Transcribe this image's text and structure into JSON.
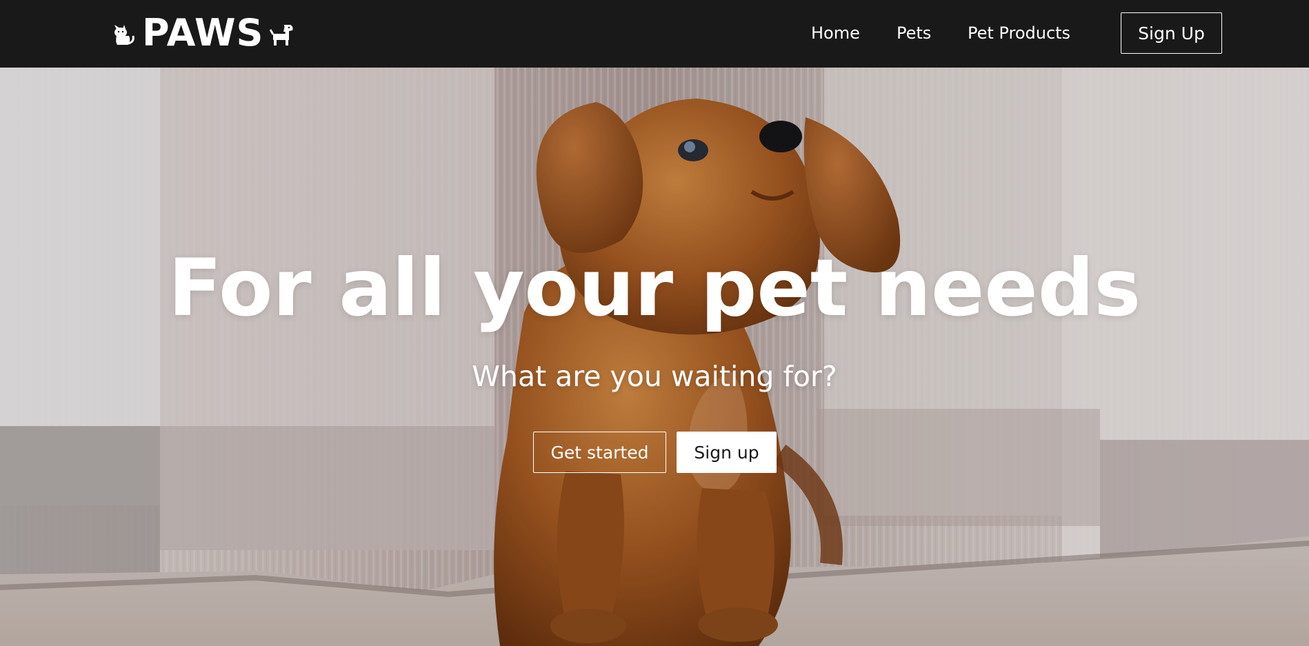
{
  "brand": {
    "name": "PAWS",
    "left_icon": "cat-icon",
    "right_icon": "dog-icon"
  },
  "nav": {
    "links": [
      {
        "label": "Home"
      },
      {
        "label": "Pets"
      },
      {
        "label": "Pet Products"
      }
    ],
    "signup_label": "Sign Up"
  },
  "hero": {
    "title": "For all your pet needs",
    "subtitle": "What are you waiting for?",
    "get_started_label": "Get started",
    "signup_label": "Sign up",
    "background": "photo of a dachshund puppy sitting between sheer curtains on carpet"
  },
  "colors": {
    "navbar": "#1a1919",
    "text": "#ffffff",
    "button_fill": "#ffffff"
  }
}
